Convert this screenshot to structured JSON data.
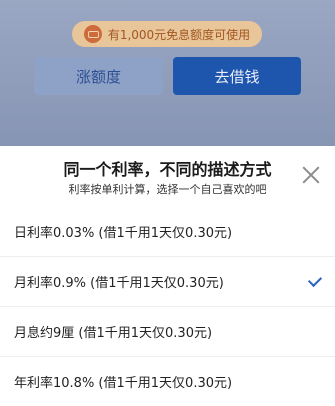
{
  "background": {
    "promo_text": "有1,000元免息额度可使用",
    "increase_label": "涨额度",
    "borrow_label": "去借钱"
  },
  "sheet": {
    "title": "同一个利率，不同的描述方式",
    "subtitle": "利率按单利计算，选择一个自己喜欢的吧",
    "options": [
      {
        "label": "日利率0.03% (借1千用1天仅0.30元)",
        "selected": false
      },
      {
        "label": "月利率0.9% (借1千用1天仅0.30元)",
        "selected": true
      },
      {
        "label": "月息约9厘 (借1千用1天仅0.30元)",
        "selected": false
      },
      {
        "label": "年利率10.8% (借1千用1天仅0.30元)",
        "selected": false
      }
    ]
  },
  "colors": {
    "accent": "#2b63c2",
    "borrow_button": "#1f56ad",
    "promo_bg": "#e9c59a"
  },
  "icons": [
    "coin-icon",
    "close-icon",
    "checkmark-icon"
  ]
}
